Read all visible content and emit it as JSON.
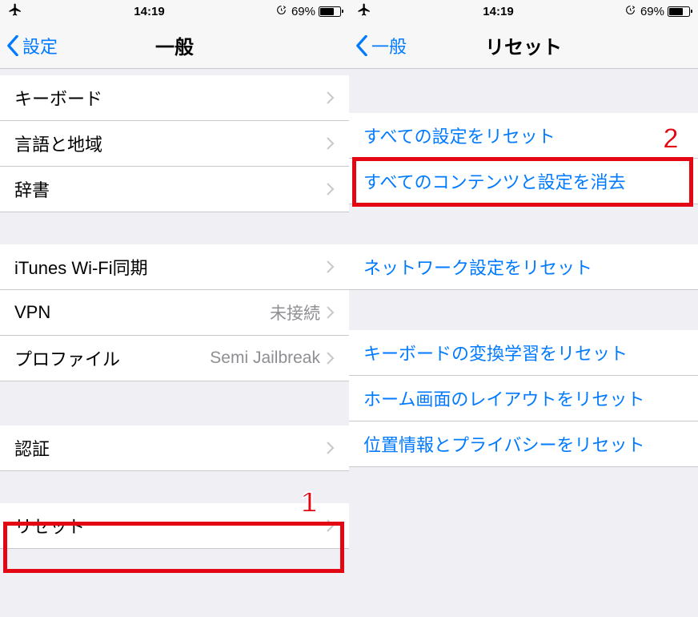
{
  "status": {
    "time": "14:19",
    "battery_pct": "69%",
    "battery_fill": 69
  },
  "left": {
    "back_label": "設定",
    "title": "一般",
    "rows": {
      "keyboard": "キーボード",
      "lang_region": "言語と地域",
      "dictionary": "辞書",
      "itunes_wifi": "iTunes Wi-Fi同期",
      "vpn": "VPN",
      "vpn_status": "未接続",
      "profile": "プロファイル",
      "profile_detail": "Semi Jailbreak",
      "auth": "認証",
      "reset": "リセット"
    }
  },
  "right": {
    "back_label": "一般",
    "title": "リセット",
    "rows": {
      "reset_all_settings": "すべての設定をリセット",
      "erase_all": "すべてのコンテンツと設定を消去",
      "reset_network": "ネットワーク設定をリセット",
      "reset_keyboard": "キーボードの変換学習をリセット",
      "reset_home": "ホーム画面のレイアウトをリセット",
      "reset_location": "位置情報とプライバシーをリセット"
    }
  },
  "annotations": {
    "one": "1",
    "two": "2"
  }
}
